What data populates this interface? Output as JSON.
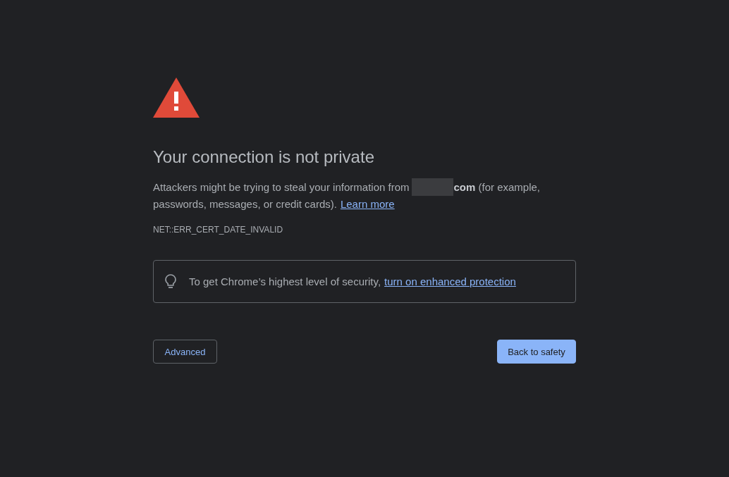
{
  "title": "Your connection is not private",
  "message": {
    "before": "Attackers might be trying to steal your information from",
    "redacted": true,
    "after": "**com** (for example, passwords, messages, or credit cards).",
    "link": "Learn more"
  },
  "error_code": "NET::ERR_CERT_DATE_INVALID",
  "tip": {
    "text": "To get Chrome’s highest level of security,",
    "link": "turn on enhanced protection"
  },
  "buttons": [
    {
      "label": "Advanced",
      "kind": "secondary"
    },
    {
      "label": "Back to safety",
      "kind": "primary"
    }
  ]
}
